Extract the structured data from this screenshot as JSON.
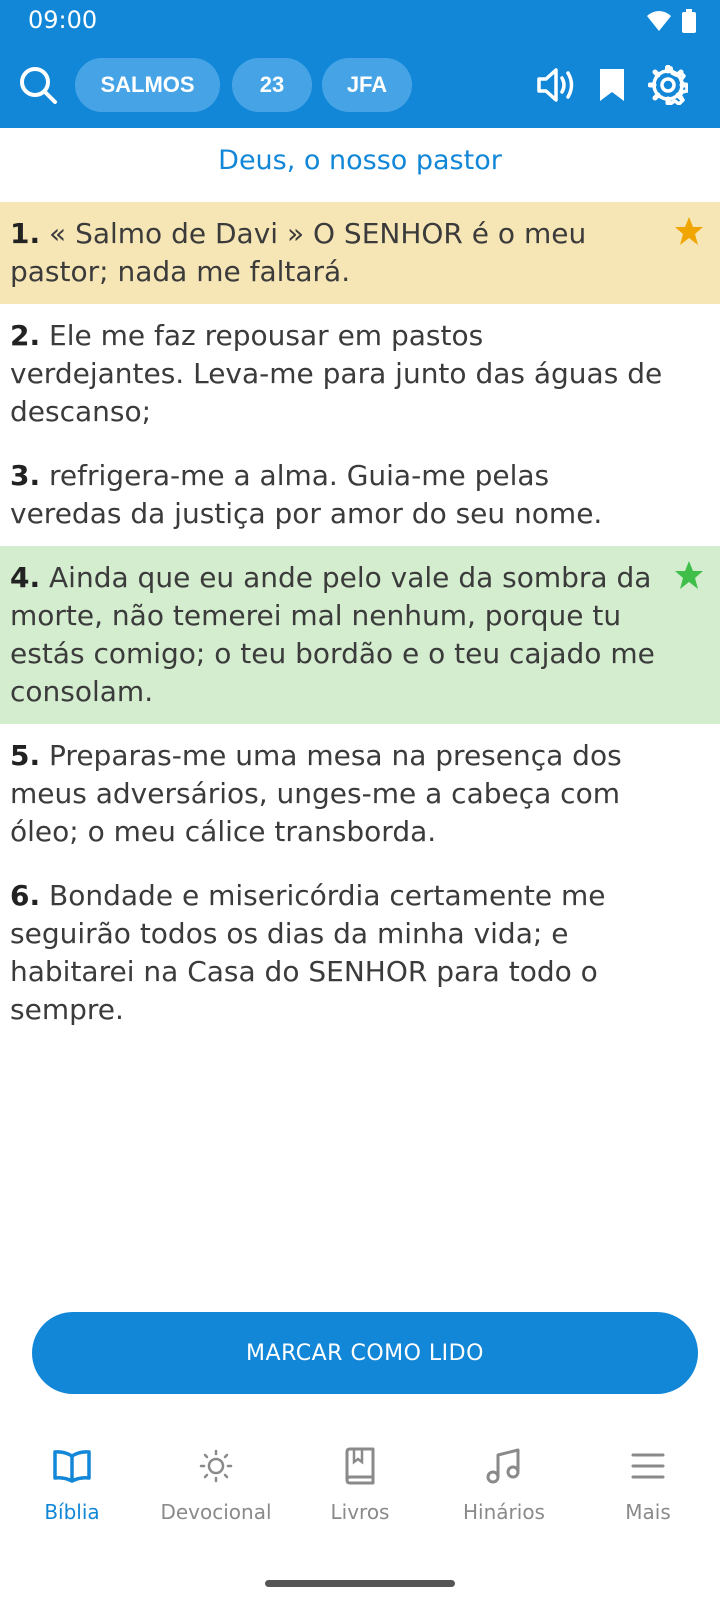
{
  "status": {
    "time": "09:00"
  },
  "header": {
    "book": "SALMOS",
    "chapter": "23",
    "version": "JFA",
    "icons": [
      "search-icon",
      "volume-icon",
      "bookmark-icon",
      "gear-icon"
    ]
  },
  "chapter_title": "Deus, o nosso pastor",
  "verses": [
    {
      "num": "1.",
      "text": "« Salmo de Davi » O SENHOR é o meu pastor; nada me faltará.",
      "highlight": "#f7e6b5",
      "star": "#f0a500"
    },
    {
      "num": "2.",
      "text": "Ele me faz repousar em pastos verdejantes. Leva-me para junto das águas de descanso;"
    },
    {
      "num": "3.",
      "text": "refrigera-me a alma. Guia-me pelas veredas da justiça por amor do seu nome."
    },
    {
      "num": "4.",
      "text": "Ainda que eu ande pelo vale da sombra da morte, não temerei mal nenhum, porque tu estás comigo; o teu bordão e o teu cajado me consolam.",
      "highlight": "#d4edcf",
      "star": "#3fbf4a"
    },
    {
      "num": "5.",
      "text": "Preparas-me uma mesa na presença dos meus adversários, unges-me a cabeça com óleo; o meu cálice transborda."
    },
    {
      "num": "6.",
      "text": "Bondade e misericórdia certamente me seguirão todos os dias da minha vida; e habitarei na Casa do SENHOR para todo o sempre."
    }
  ],
  "mark_read_label": "MARCAR COMO LIDO",
  "nav": {
    "active": "Bíblia",
    "items": [
      {
        "label": "Bíblia",
        "icon": "book-open-icon"
      },
      {
        "label": "Devocional",
        "icon": "sun-icon"
      },
      {
        "label": "Livros",
        "icon": "book-icon"
      },
      {
        "label": "Hinários",
        "icon": "music-icon"
      },
      {
        "label": "Mais",
        "icon": "menu-icon"
      }
    ]
  },
  "colors": {
    "primary": "#1287d8",
    "pill": "#46a4e6",
    "inactive": "#8a8a8a"
  }
}
